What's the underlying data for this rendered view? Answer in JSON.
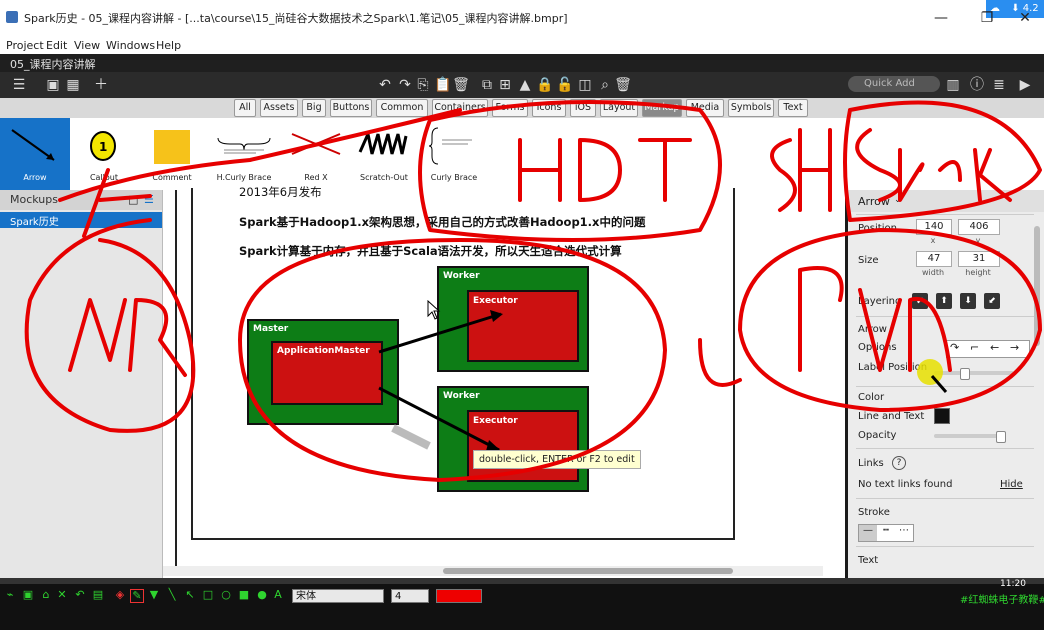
{
  "window": {
    "title": "Spark历史 - 05_课程内容讲解 - [...ta\\course\\15_尚硅谷大数据技术之Spark\\1.笔记\\05_课程内容讲解.bmpr]",
    "badge": "4.2"
  },
  "menu": [
    "Project",
    "Edit",
    "View",
    "Windows",
    "Help"
  ],
  "doc_tab": "05_课程内容讲解",
  "toolbar": {
    "quick_add_placeholder": "Quick Add"
  },
  "filters": [
    "All",
    "Assets",
    "Big",
    "Buttons",
    "Common",
    "Containers",
    "Forms",
    "Icons",
    "iOS",
    "Layout",
    "Markup",
    "Media",
    "Symbols",
    "Text"
  ],
  "active_filter": "Markup",
  "library": [
    "Arrow",
    "Callout",
    "Comment",
    "H.Curly Brace",
    "Red X",
    "Scratch-Out",
    "Curly Brace"
  ],
  "library_selected": "Arrow",
  "mockups": {
    "header": "Mockups",
    "items": [
      "Spark历史"
    ]
  },
  "canvas": {
    "lines": [
      "2013年6月发布",
      "Spark基于Hadoop1.x架构思想，采用自己的方式改善Hadoop1.x中的问题",
      "Spark计算基于内存，并且基于Scala语法开发，所以天生适合迭代式计算"
    ],
    "master_label": "Master",
    "app_master_label": "ApplicationMaster",
    "worker_label": "Worker",
    "executor_label": "Executor",
    "tooltip": "double-click, ENTER or F2 to edit"
  },
  "inspector": {
    "control_name": "Arrow",
    "position_label": "Position",
    "x": "140",
    "y": "406",
    "x_sub": "x",
    "y_sub": "y",
    "size_label": "Size",
    "w": "47",
    "h": "31",
    "w_sub": "width",
    "h_sub": "height",
    "layering_label": "Layering",
    "arrow_section": "Arrow",
    "options_label": "Options",
    "label_position_label": "Label Position",
    "color_section": "Color",
    "line_text_label": "Line and Text",
    "opacity_label": "Opacity",
    "links_section": "Links",
    "links_help": "?",
    "no_links": "No text links found",
    "hide_link": "Hide",
    "stroke_section": "Stroke",
    "text_section": "Text",
    "line_color": "#111111"
  },
  "bottombar": {
    "font": "宋体",
    "size": "4",
    "pen_color": "#ee0000",
    "watermark": "#红蜘蛛电子教鞭#",
    "clock": "11:20"
  },
  "colors": {
    "accent": "#1672c8",
    "annotation": "#e60000",
    "worker": "#0d7d16",
    "executor": "#cc1111"
  }
}
